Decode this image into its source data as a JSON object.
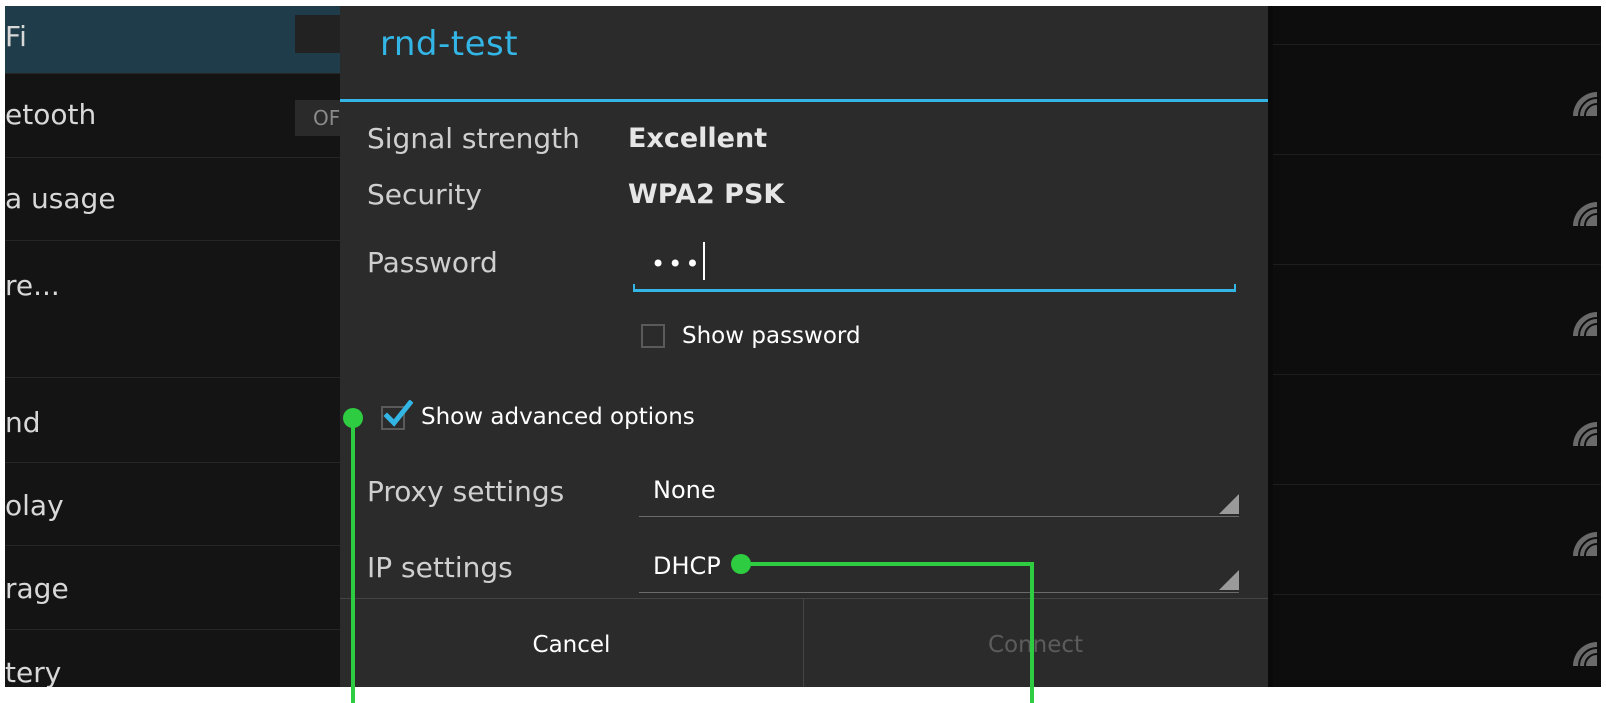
{
  "left_list": {
    "items": [
      {
        "label": "Fi",
        "selected": true
      },
      {
        "label": "etooth",
        "toggle": "OF"
      },
      {
        "label": "a usage"
      },
      {
        "label": "re..."
      },
      {
        "label": "nd"
      },
      {
        "label": "olay"
      },
      {
        "label": "rage"
      },
      {
        "label": "tery"
      }
    ]
  },
  "dialog": {
    "title": "rnd-test",
    "signal_label": "Signal strength",
    "signal_value": "Excellent",
    "security_label": "Security",
    "security_value": "WPA2 PSK",
    "password_label": "Password",
    "password_value": "•••",
    "show_password_label": "Show password",
    "show_password_checked": false,
    "advanced_label": "Show advanced options",
    "advanced_checked": true,
    "proxy_label": "Proxy settings",
    "proxy_value": "None",
    "ip_label": "IP settings",
    "ip_value": "DHCP",
    "cancel_label": "Cancel",
    "connect_label": "Connect"
  },
  "colors": {
    "accent": "#33b5e5",
    "annotation": "#2ecc40"
  }
}
